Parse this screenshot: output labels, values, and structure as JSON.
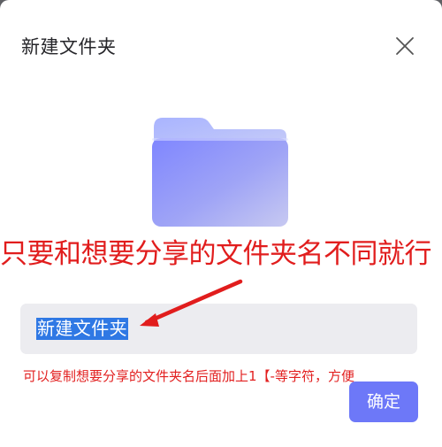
{
  "dialog": {
    "title": "新建文件夹"
  },
  "annotation": {
    "headline": "只要和想要分享的文件夹名不同就行",
    "hint": "可以复制想要分享的文件夹名后面加上1【-等字符，方便"
  },
  "name_field": {
    "value": "新建文件夹"
  },
  "actions": {
    "confirm_label": "确定"
  },
  "colors": {
    "accent": "#6d78f8",
    "annotation_red": "#e11d1d",
    "selection": "#2f78e4"
  },
  "icons": {
    "close": "close-icon",
    "folder": "folder-icon",
    "arrow": "red-arrow-annotation"
  }
}
